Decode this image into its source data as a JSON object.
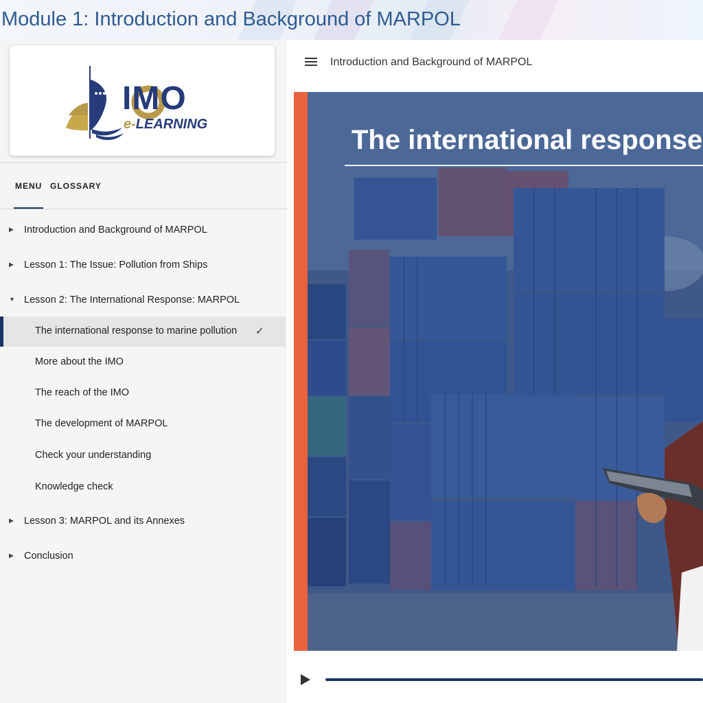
{
  "module_title": "Module 1: Introduction and Background of MARPOL",
  "logo": {
    "primary": "IMO",
    "secondary_prefix": "e-",
    "secondary": "LEARNING"
  },
  "tabs": {
    "menu": "MENU",
    "glossary": "GLOSSARY"
  },
  "nav": {
    "sections": [
      {
        "label": "Introduction and Background of MARPOL",
        "expanded": false
      },
      {
        "label": "Lesson 1: The Issue: Pollution from Ships",
        "expanded": false
      },
      {
        "label": "Lesson 2: The International Response: MARPOL",
        "expanded": true
      },
      {
        "label": "Lesson 3: MARPOL and its Annexes",
        "expanded": false
      },
      {
        "label": "Conclusion",
        "expanded": false
      }
    ],
    "lesson2_items": [
      {
        "label": "The international response to marine pollution",
        "active": true,
        "completed": true
      },
      {
        "label": "More about the IMO",
        "active": false,
        "completed": false
      },
      {
        "label": "The reach of the IMO",
        "active": false,
        "completed": false
      },
      {
        "label": "The development of MARPOL",
        "active": false,
        "completed": false
      },
      {
        "label": "Check your understanding",
        "active": false,
        "completed": false
      },
      {
        "label": "Knowledge check",
        "active": false,
        "completed": false
      }
    ]
  },
  "main": {
    "title": "Introduction and Background of MARPOL",
    "slide_heading": "The international response to marine pollution"
  },
  "icons": {
    "collapsed": "caret-right-icon",
    "expanded": "caret-down-icon",
    "check": "check-icon",
    "menu": "hamburger-icon",
    "play": "play-icon"
  },
  "colors": {
    "brand_navy": "#1d3565",
    "accent_orange": "#ea623c",
    "title_blue": "#2f5b91",
    "logo_gold": "#b89a4a"
  }
}
